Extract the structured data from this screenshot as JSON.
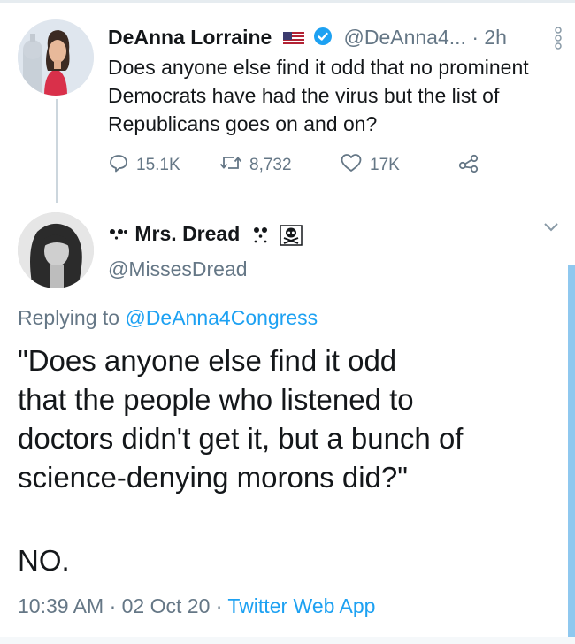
{
  "tweet1": {
    "author_name": "DeAnna Lorraine",
    "handle": "@DeAnna4...",
    "separator": "·",
    "time": "2h",
    "text": "Does anyone else find it odd that no prominent Democrats have had the virus but the list of Republicans goes on and on?",
    "reply_count": "15.1K",
    "retweet_count": "8,732",
    "like_count": "17K"
  },
  "tweet2": {
    "author_name": "Mrs. Dread",
    "handle": "@MissesDread",
    "replying_prefix": "Replying to",
    "replying_handle": "@DeAnna4Congress",
    "text_lines": [
      "\"Does anyone else find it odd",
      "that the people who listened to",
      "doctors didn't get it, but a bunch of",
      "science-denying morons did?\""
    ],
    "text_final": "NO.",
    "time": "10:39 AM",
    "dot1": "·",
    "date": "02 Oct 20",
    "dot2": "·",
    "client": "Twitter Web App"
  },
  "colors": {
    "text": "#14171a",
    "muted": "#657786",
    "link": "#1da1f2",
    "verified": "#1da1f2"
  },
  "icons": [
    "reply-icon",
    "retweet-icon",
    "like-icon",
    "share-icon",
    "verified-badge-icon",
    "us-flag-icon",
    "more-icon",
    "chevron-down-icon",
    "ghost-icon",
    "skull-crossbones-icon"
  ]
}
